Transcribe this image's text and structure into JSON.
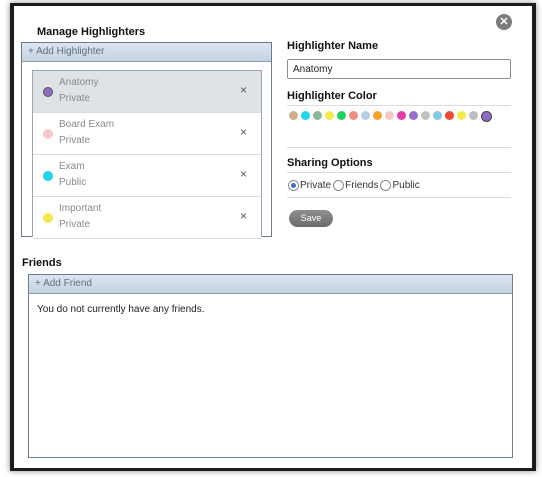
{
  "close_icon": "x-close-icon",
  "highlighters": {
    "title": "Manage Highlighters",
    "add_label": "+ Add Highlighter",
    "items": [
      {
        "name": "Anatomy",
        "sharing": "Private",
        "color": "#8f6cc4",
        "remove": "×"
      },
      {
        "name": "Board Exam",
        "sharing": "Private",
        "color": "#f5c9c6",
        "remove": "×"
      },
      {
        "name": "Exam",
        "sharing": "Public",
        "color": "#22d3ee",
        "remove": "×"
      },
      {
        "name": "Important",
        "sharing": "Private",
        "color": "#f7e94a",
        "remove": "×"
      }
    ]
  },
  "form": {
    "name_label": "Highlighter Name",
    "name_value": "Anatomy",
    "color_label": "Highlighter Color",
    "colors": [
      "#cdb08b",
      "#22d3ee",
      "#8fb59a",
      "#f7e94a",
      "#1fd35e",
      "#ef8c7e",
      "#b8cce4",
      "#f7a130",
      "#f5c9c6",
      "#e53aa8",
      "#9a6fd0",
      "#c0c0c0",
      "#85c7e9",
      "#ee4b3a",
      "#f7e94a",
      "#bdbdbd",
      "#8f6cc4"
    ],
    "selected_color_index": 16,
    "sharing_label": "Sharing Options",
    "sharing_options": [
      "Private",
      "Friends",
      "Public"
    ],
    "sharing_selected": "Private",
    "save_label": "Save"
  },
  "friends": {
    "title": "Friends",
    "add_label": "+ Add Friend",
    "empty_text": "You do not currently have any friends."
  }
}
